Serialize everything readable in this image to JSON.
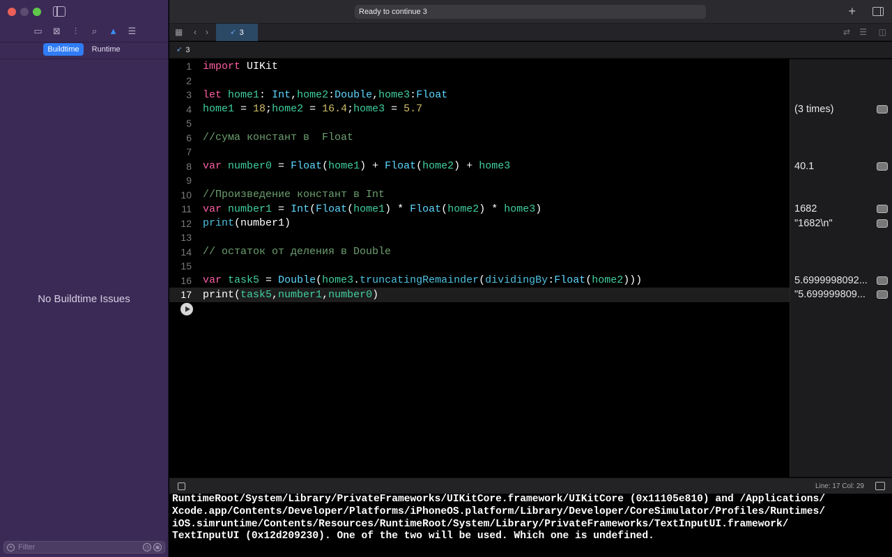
{
  "window": {
    "status": "Ready to continue 3"
  },
  "sidebar": {
    "segments": [
      {
        "label": "Buildtime",
        "selected": true
      },
      {
        "label": "Runtime",
        "selected": false
      }
    ],
    "empty_message": "No Buildtime Issues",
    "filter_placeholder": "Filter"
  },
  "tab": {
    "label": "3"
  },
  "breadcrumb": {
    "label": "3"
  },
  "editor": {
    "current_line": 17,
    "lines": [
      {
        "n": "1",
        "tokens": [
          [
            "kw",
            "import"
          ],
          [
            "plain",
            " UIKit"
          ]
        ]
      },
      {
        "n": "2",
        "tokens": []
      },
      {
        "n": "3",
        "tokens": [
          [
            "kw",
            "let"
          ],
          [
            "plain",
            " "
          ],
          [
            "var",
            "home1"
          ],
          [
            "plain",
            ": "
          ],
          [
            "typ",
            "Int"
          ],
          [
            "plain",
            ","
          ],
          [
            "var",
            "home2"
          ],
          [
            "plain",
            ":"
          ],
          [
            "typ",
            "Double"
          ],
          [
            "plain",
            ","
          ],
          [
            "var",
            "home3"
          ],
          [
            "plain",
            ":"
          ],
          [
            "typ",
            "Float"
          ]
        ]
      },
      {
        "n": "4",
        "tokens": [
          [
            "var",
            "home1"
          ],
          [
            "plain",
            " = "
          ],
          [
            "num",
            "18"
          ],
          [
            "plain",
            ";"
          ],
          [
            "var",
            "home2"
          ],
          [
            "plain",
            " = "
          ],
          [
            "num",
            "16.4"
          ],
          [
            "plain",
            ";"
          ],
          [
            "var",
            "home3"
          ],
          [
            "plain",
            " = "
          ],
          [
            "num",
            "5.7"
          ]
        ]
      },
      {
        "n": "5",
        "tokens": []
      },
      {
        "n": "6",
        "tokens": [
          [
            "cm",
            "//сума констант в  Float"
          ]
        ]
      },
      {
        "n": "7",
        "tokens": []
      },
      {
        "n": "8",
        "tokens": [
          [
            "kw",
            "var"
          ],
          [
            "plain",
            " "
          ],
          [
            "var",
            "number0"
          ],
          [
            "plain",
            " = "
          ],
          [
            "typ",
            "Float"
          ],
          [
            "plain",
            "("
          ],
          [
            "var",
            "home1"
          ],
          [
            "plain",
            ") + "
          ],
          [
            "typ",
            "Float"
          ],
          [
            "plain",
            "("
          ],
          [
            "var",
            "home2"
          ],
          [
            "plain",
            ") + "
          ],
          [
            "var",
            "home3"
          ]
        ]
      },
      {
        "n": "9",
        "tokens": []
      },
      {
        "n": "10",
        "tokens": [
          [
            "cm",
            "//Произведение констант в Int"
          ]
        ]
      },
      {
        "n": "11",
        "tokens": [
          [
            "kw",
            "var"
          ],
          [
            "plain",
            " "
          ],
          [
            "var",
            "number1"
          ],
          [
            "plain",
            " = "
          ],
          [
            "typ",
            "Int"
          ],
          [
            "plain",
            "("
          ],
          [
            "typ",
            "Float"
          ],
          [
            "plain",
            "("
          ],
          [
            "var",
            "home1"
          ],
          [
            "plain",
            ") * "
          ],
          [
            "typ",
            "Float"
          ],
          [
            "plain",
            "("
          ],
          [
            "var",
            "home2"
          ],
          [
            "plain",
            ") * "
          ],
          [
            "var",
            "home3"
          ],
          [
            "plain",
            ")"
          ]
        ]
      },
      {
        "n": "12",
        "tokens": [
          [
            "fn",
            "print"
          ],
          [
            "plain",
            "(number1)"
          ]
        ]
      },
      {
        "n": "13",
        "tokens": []
      },
      {
        "n": "14",
        "tokens": [
          [
            "cm",
            "// остаток от деления в Double"
          ]
        ]
      },
      {
        "n": "15",
        "tokens": []
      },
      {
        "n": "16",
        "tokens": [
          [
            "kw",
            "var"
          ],
          [
            "plain",
            " "
          ],
          [
            "var",
            "task5"
          ],
          [
            "plain",
            " = "
          ],
          [
            "typ",
            "Double"
          ],
          [
            "plain",
            "("
          ],
          [
            "var",
            "home3"
          ],
          [
            "plain",
            "."
          ],
          [
            "fn",
            "truncatingRemainder"
          ],
          [
            "plain",
            "("
          ],
          [
            "fn",
            "dividingBy"
          ],
          [
            "plain",
            ":"
          ],
          [
            "typ",
            "Float"
          ],
          [
            "plain",
            "("
          ],
          [
            "var",
            "home2"
          ],
          [
            "plain",
            ")))"
          ]
        ]
      },
      {
        "n": "17",
        "tokens": [
          [
            "plain",
            "print("
          ],
          [
            "var",
            "task5"
          ],
          [
            "plain",
            ","
          ],
          [
            "var",
            "number1"
          ],
          [
            "plain",
            ","
          ],
          [
            "var",
            "number0"
          ],
          [
            "plain",
            ")"
          ]
        ]
      }
    ]
  },
  "results": [
    {
      "line": 4,
      "text": "(3 times)"
    },
    {
      "line": 8,
      "text": "40.1"
    },
    {
      "line": 11,
      "text": "1682"
    },
    {
      "line": 12,
      "text": "\"1682\\n\""
    },
    {
      "line": 16,
      "text": "5.6999998092..."
    },
    {
      "line": 17,
      "text": "\"5.699999809..."
    }
  ],
  "status_bar": {
    "line_col": "Line: 17  Col: 29"
  },
  "console": {
    "lines": [
      "RuntimeRoot/System/Library/PrivateFrameworks/UIKitCore.framework/UIKitCore (0x11105e810) and /Applications/",
      "Xcode.app/Contents/Developer/Platforms/iPhoneOS.platform/Library/Developer/CoreSimulator/Profiles/Runtimes/",
      "iOS.simruntime/Contents/Resources/RuntimeRoot/System/Library/PrivateFrameworks/TextInputUI.framework/",
      "TextInputUI (0x12d209230). One of the two will be used. Which one is undefined."
    ]
  }
}
